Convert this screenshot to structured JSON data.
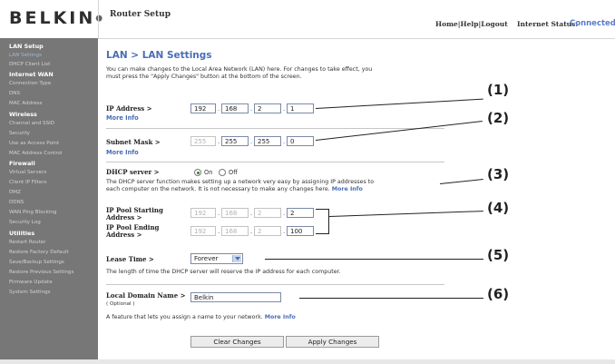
{
  "header": {
    "logo": "BELKIN",
    "logo_mark": "●",
    "title": "Router Setup",
    "links": [
      "Home",
      "Help",
      "Logout"
    ],
    "link_separator": "|",
    "status_label": "Internet Status:",
    "status_value": "Connected"
  },
  "sidebar": {
    "sections": [
      {
        "heading": "LAN Setup",
        "items": [
          "LAN Settings",
          "DHCP Client List"
        ]
      },
      {
        "heading": "Internet WAN",
        "items": [
          "Connection Type",
          "DNS",
          "MAC Address"
        ]
      },
      {
        "heading": "Wireless",
        "items": [
          "Channel and SSID",
          "Security",
          "Use as Access Point",
          "MAC Address Control"
        ]
      },
      {
        "heading": "Firewall",
        "items": [
          "Virtual Servers",
          "Client IP Filters",
          "DMZ",
          "DDNS",
          "WAN Ping Blocking",
          "Security Log"
        ]
      },
      {
        "heading": "Utilities",
        "items": [
          "Restart Router",
          "Restore Factory Default",
          "Save/Backup Settings",
          "Restore Previous Settings",
          "Firmware Update",
          "System Settings"
        ]
      }
    ],
    "active_item": "LAN Settings"
  },
  "main": {
    "title": "LAN > LAN Settings",
    "intro": [
      "You can make changes to the Local Area Network (LAN) here. For changes to take effect, you",
      "must press the \"Apply Changes\" button at the bottom of the screen."
    ],
    "more_info": "More Info",
    "ip_address": {
      "label": "IP Address >",
      "octets": [
        "192",
        "168",
        "2",
        "1"
      ]
    },
    "subnet_mask": {
      "label": "Subnet Mask >",
      "octets": [
        "255",
        "255",
        "255",
        "0"
      ]
    },
    "dhcp": {
      "label": "DHCP server >",
      "on_label": "On",
      "off_label": "Off",
      "selected": "On",
      "description": [
        "The DHCP server function makes setting up a network very easy by assigning IP addresses to",
        "each computer on the network. It is not necessary to make any changes here."
      ]
    },
    "pool_start": {
      "label_lines": [
        "IP Pool Starting",
        "Address >"
      ],
      "octets": [
        "192",
        "168",
        "2",
        "2"
      ]
    },
    "pool_end": {
      "label_lines": [
        "IP Pool Ending",
        "Address >"
      ],
      "octets": [
        "192",
        "168",
        "2",
        "100"
      ]
    },
    "lease": {
      "label": "Lease Time >",
      "value": "Forever",
      "description": "The length of time the DHCP server will reserve the IP address for each computer."
    },
    "domain": {
      "label": "Local Domain Name >",
      "optional": "( Optional )",
      "value": "Belkin",
      "description": "A feature that lets you assign a name to your network."
    },
    "buttons": {
      "clear": "Clear Changes",
      "apply": "Apply Changes"
    }
  },
  "callouts": [
    "(1)",
    "(2)",
    "(3)",
    "(4)",
    "(5)",
    "(6)"
  ]
}
